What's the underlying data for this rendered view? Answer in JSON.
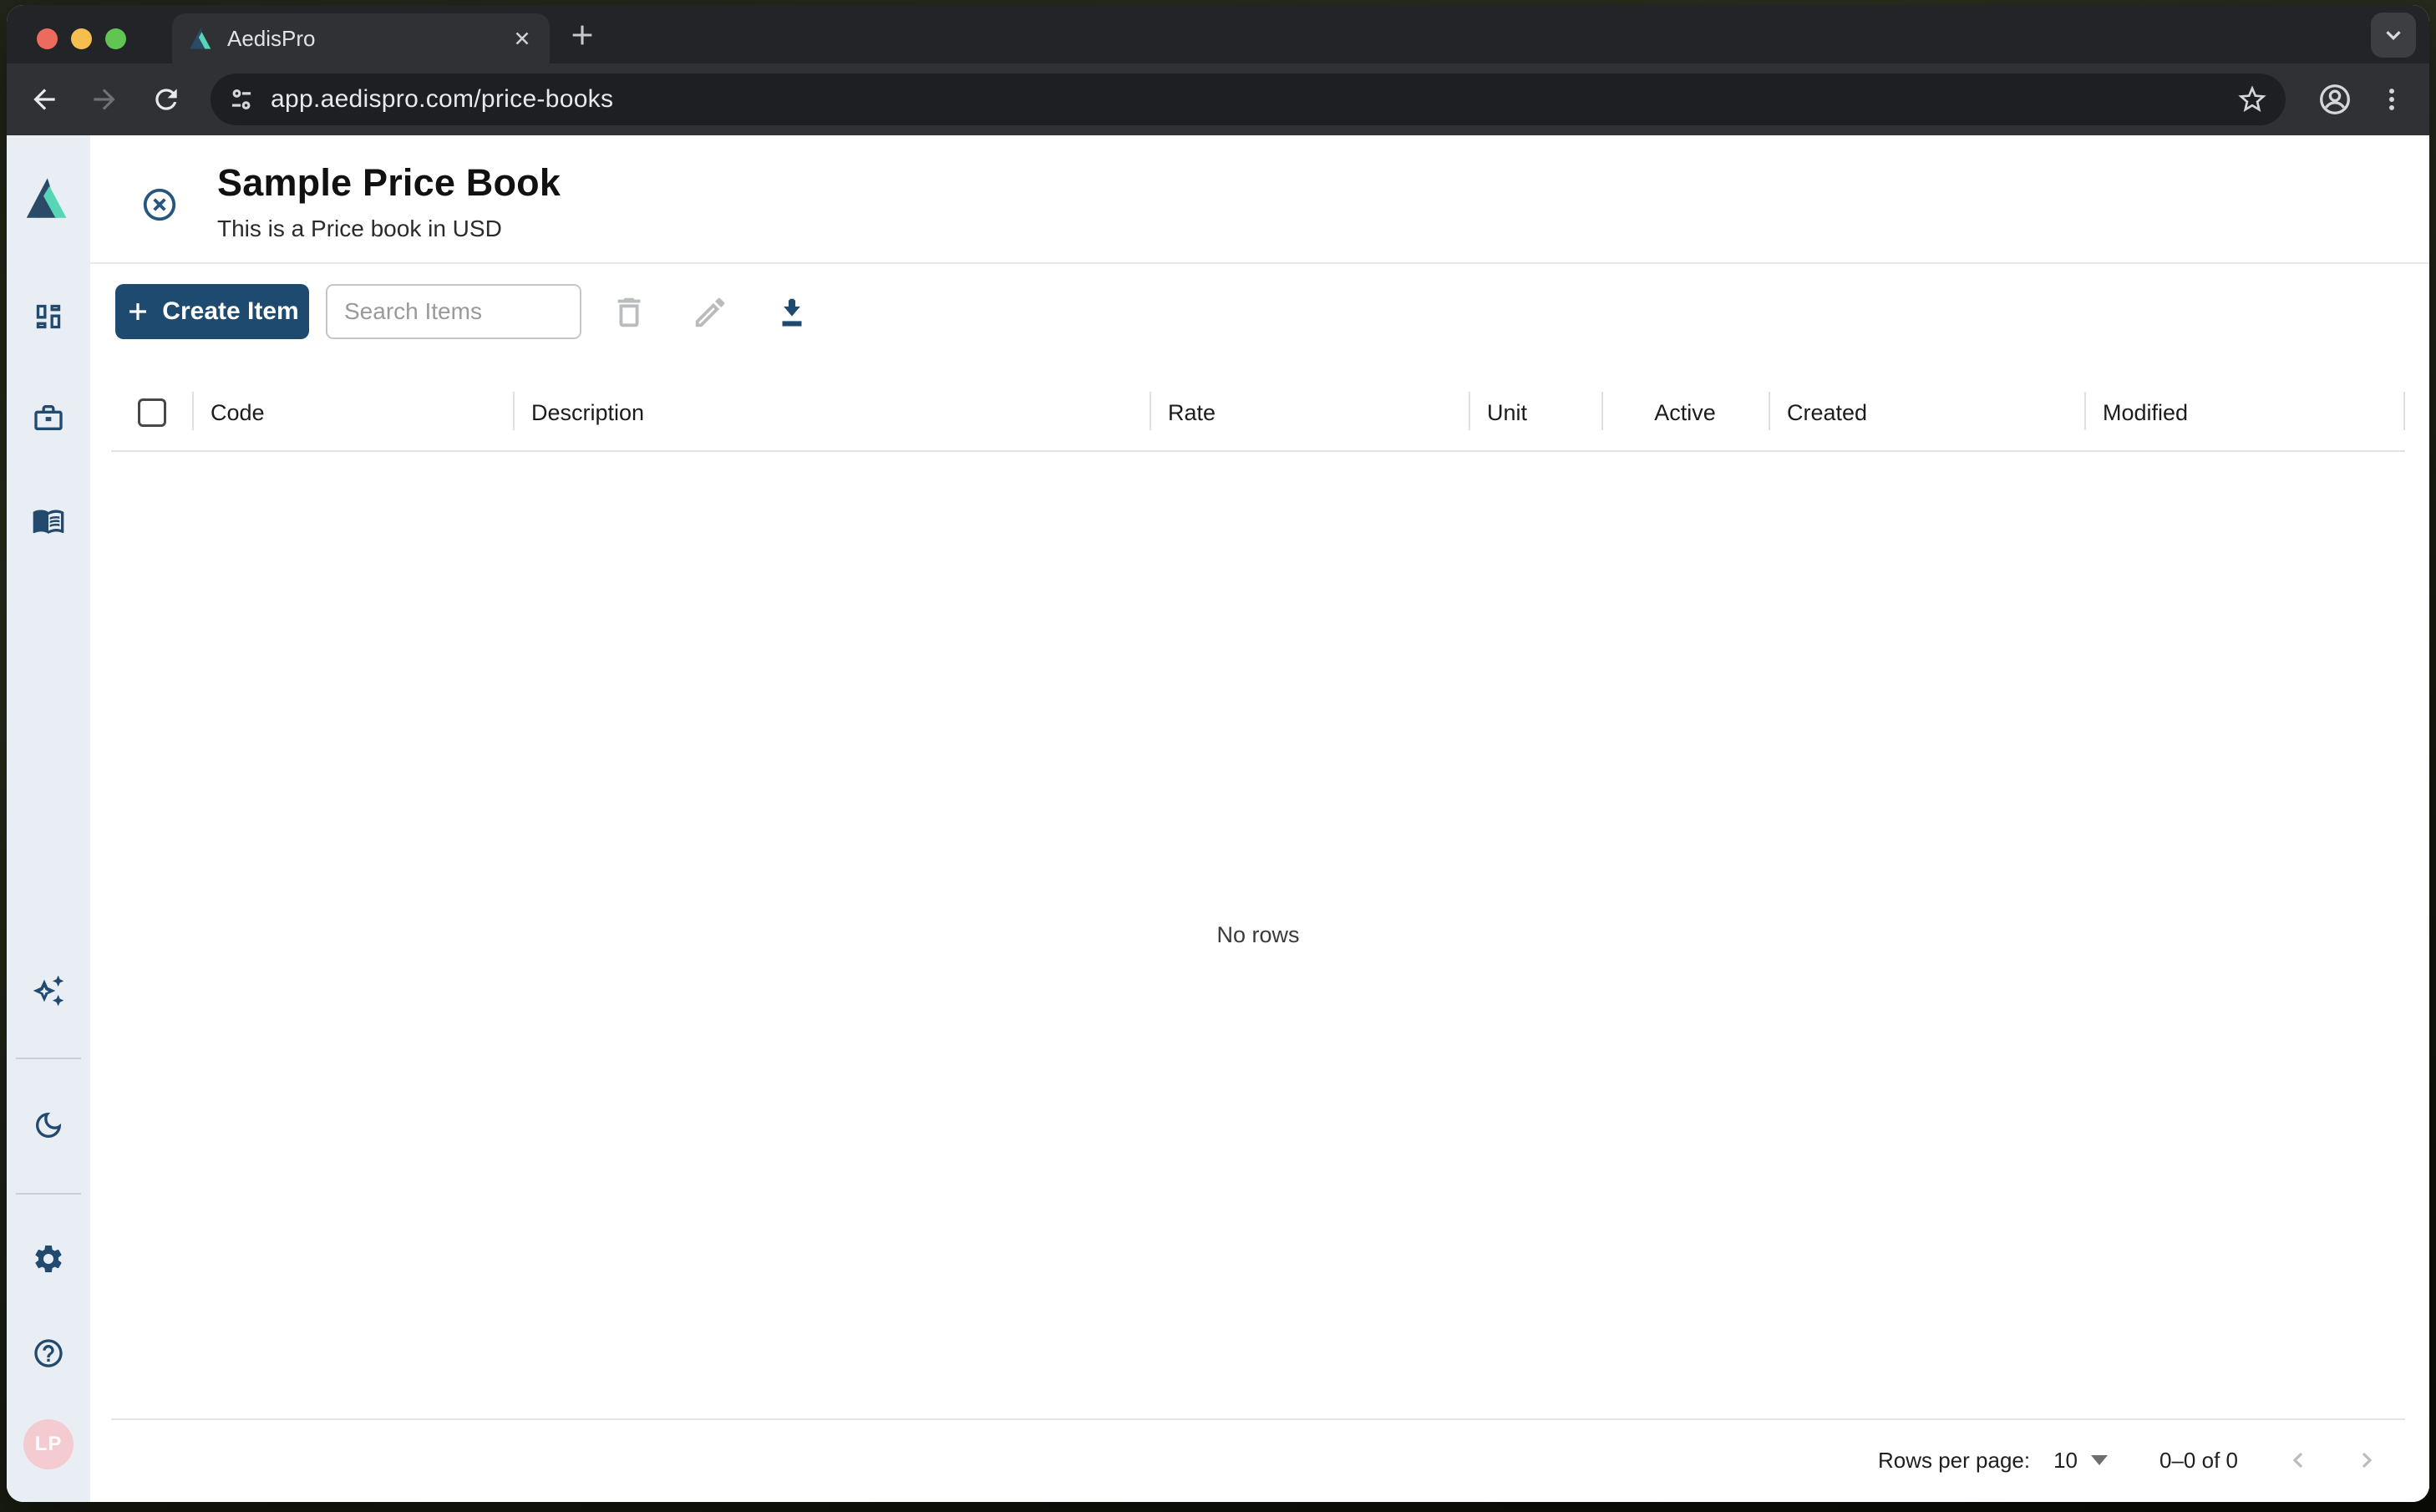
{
  "browser": {
    "tab_title": "AedisPro",
    "url": "app.aedispro.com/price-books"
  },
  "page": {
    "title": "Sample Price Book",
    "subtitle": "This is a Price book in USD",
    "create_button_label": "Create Item",
    "search_placeholder": "Search Items",
    "table": {
      "columns": [
        "Code",
        "Description",
        "Rate",
        "Unit",
        "Active",
        "Created",
        "Modified"
      ],
      "empty_text": "No rows"
    },
    "pagination": {
      "rows_per_page_label": "Rows per page:",
      "rows_per_page_value": "10",
      "range_text": "0–0 of 0"
    }
  },
  "user": {
    "avatar_initials": "LP"
  },
  "colors": {
    "brand_navy": "#1e4a6f",
    "sidebar_icon_blue": "#214a6e",
    "logo_teal": "#56d6b4",
    "avatar_pink": "#f3cbd0"
  }
}
